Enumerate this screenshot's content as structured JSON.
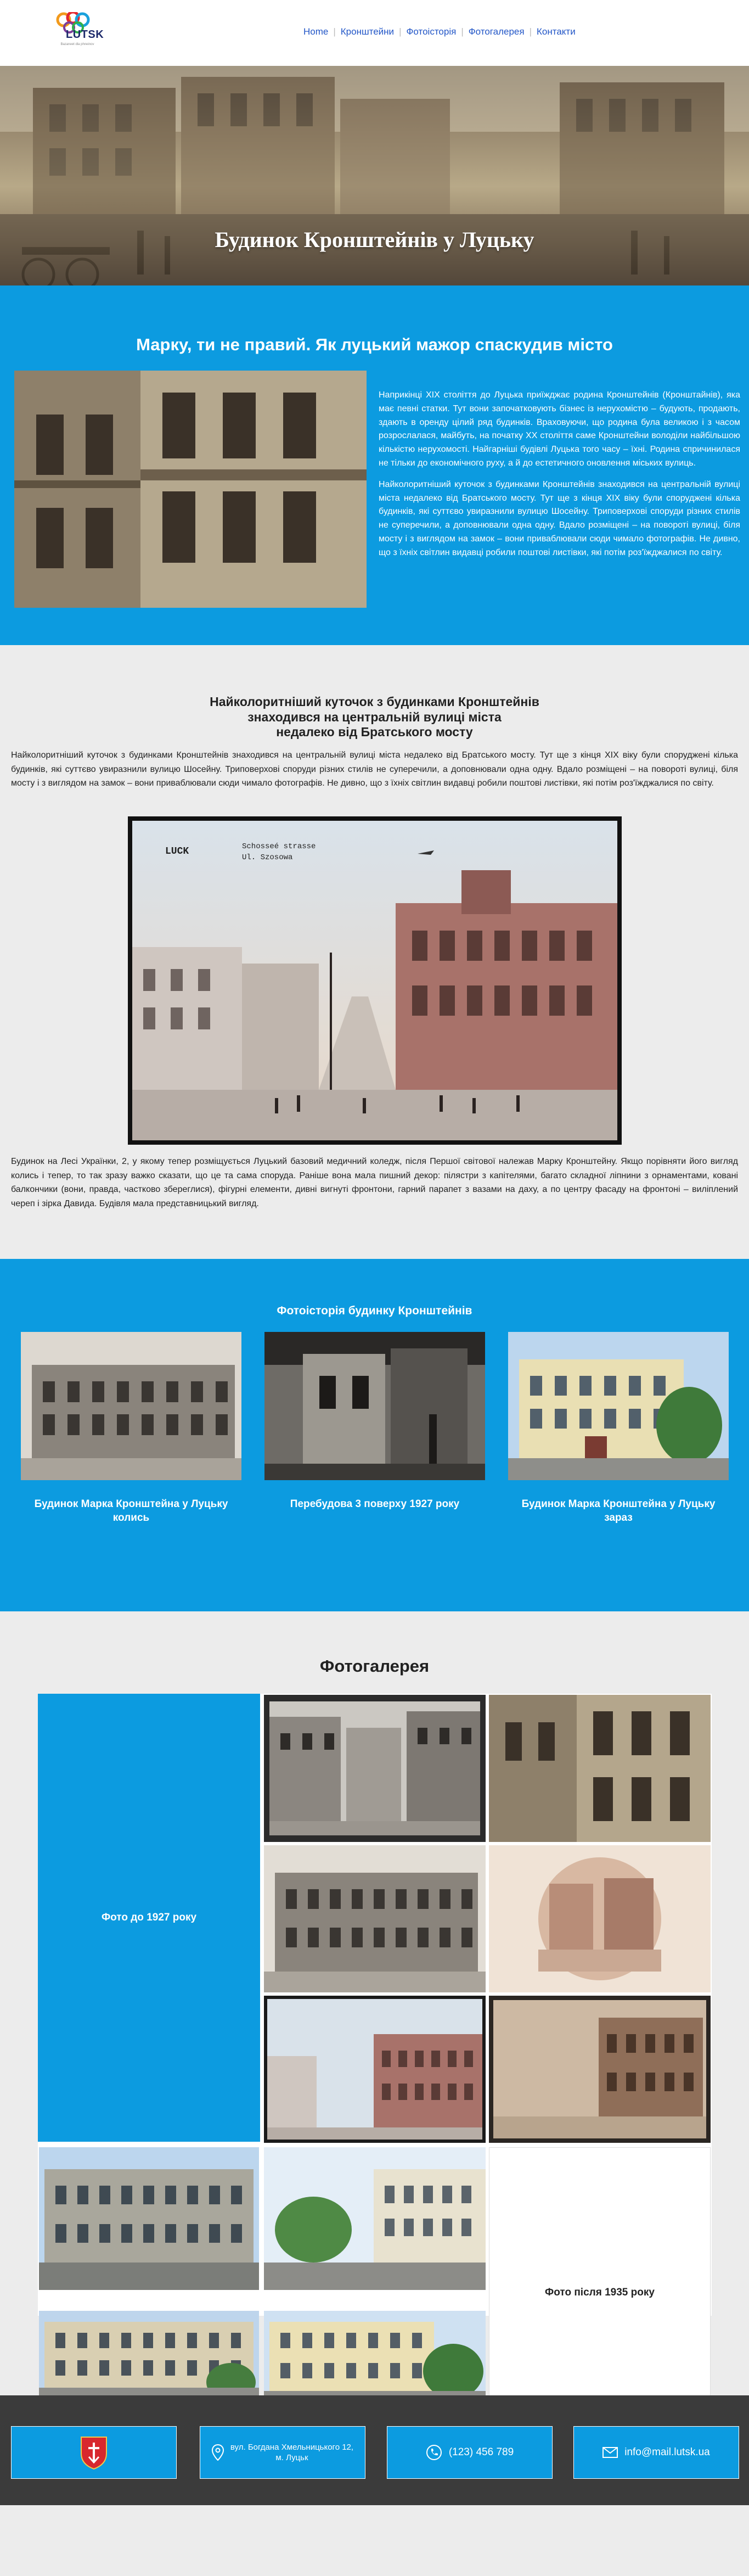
{
  "header": {
    "logo_text": "LUTSK",
    "logo_tagline": "Bazaneet dla phneinov",
    "nav": [
      {
        "label": "Home"
      },
      {
        "label": "Кронштейни"
      },
      {
        "label": "Фотоісторія"
      },
      {
        "label": "Фотогалерея"
      },
      {
        "label": "Контакти"
      }
    ]
  },
  "hero": {
    "title": "Будинок Кронштейнів у Луцьку"
  },
  "section1": {
    "title": "Марку, ти не правий. Як луцький мажор спаскудив місто",
    "p1": "Наприкінці XIX століття до Луцька приїжджає родина Кронштейнів (Кронштайнів), яка має певні статки. Тут вони започатковують бізнес із нерухомістю – будують, продають, здають в оренду цілий ряд будинків. Враховуючи, що родина була великою і з часом розрослалася, майбуть, на початку XX століття саме Кронштейни володіли найбільшою кількістю нерухомості. Найгарніші будівлі Луцька того часу – їхні. Родина спричинилася не тільки до економічного руху, а й до естетичного оновлення міських вулиць.",
    "p2": "Найколоритніший куточок з будинками Кронштейнів знаходився на центральній вулиці міста недалеко від Братського мосту. Тут ще з кінця XIX віку були споруджені кілька будинків, які суттєво увиразнили вулицю Шосейну. Триповерхові споруди різних стилів не суперечили, а доповнювали одна одну. Вдало розміщені – на повороті вулиці, біля мосту і з виглядом на замок – вони приваблювали сюди чимало фотографів. Не дивно, що з їхніх світлин видавці робили поштові листівки, які потім роз'їжджалися по світу."
  },
  "section2": {
    "title_line1": "Найколоритніший куточок з будинками Кронштейнів",
    "title_line2": "знаходився на центральній вулиці міста",
    "title_line3": "недалеко від Братського мосту",
    "p1": "Найколоритніший куточок з будинками Кронштейнів знаходився на центральній вулиці міста недалеко від Братського мосту. Тут ще з кінця XIX віку були споруджені кілька будинків, які суттєво увиразнили вулицю Шосейну. Триповерхові споруди різних стилів не суперечили, а доповнювали одна одну. Вдало розміщені – на повороті вулиці, біля мосту і з виглядом на замок – вони приваблювали сюди чимало фотографів. Не дивно, що з їхніх світлин видавці робили поштові листівки, які потім роз'їжджалися по світу.",
    "postcard_line1": "LUCK",
    "postcard_line2": "Schosseé strasse",
    "postcard_line3": "Ul. Szosowa",
    "p2": "Будинок на Лесі Українки, 2, у якому тепер розміщується Луцький базовий медичний коледж, після Першої світової належав Марку Кронштейну. Якщо порівняти його вигляд колись і тепер, то так зразу важко сказати, що це та сама споруда. Раніше вона мала пишний декор: пілястри з капітелями, багато складної ліпнини з орнаментами, ковані балкончики (вони, правда, частково збереглися), фігурні елементи, дивні вигнуті фронтони, гарний парапет з вазами на даху, а по центру фасаду на фронтоні – виліплений череп і зірка Давида. Будівля мала представницький вигляд."
  },
  "section3": {
    "title": "Фотоісторія будинку Кронштейнів",
    "cards": [
      {
        "caption": "Будинок Марка Кронштейна у Луцьку колись"
      },
      {
        "caption": "Перебудова 3 поверху 1927 року"
      },
      {
        "caption": "Будинок Марка Кронштейна у Луцьку зараз"
      }
    ]
  },
  "gallery": {
    "title": "Фотогалерея",
    "before_label": "Фото до 1927 року",
    "after_label": "Фото після 1935 року"
  },
  "footer": {
    "address_line1": "вул. Богдана Хмельницького 12,",
    "address_line2": "м. Луцьк",
    "phone": "(123) 456 789",
    "email": "info@mail.lutsk.ua"
  }
}
